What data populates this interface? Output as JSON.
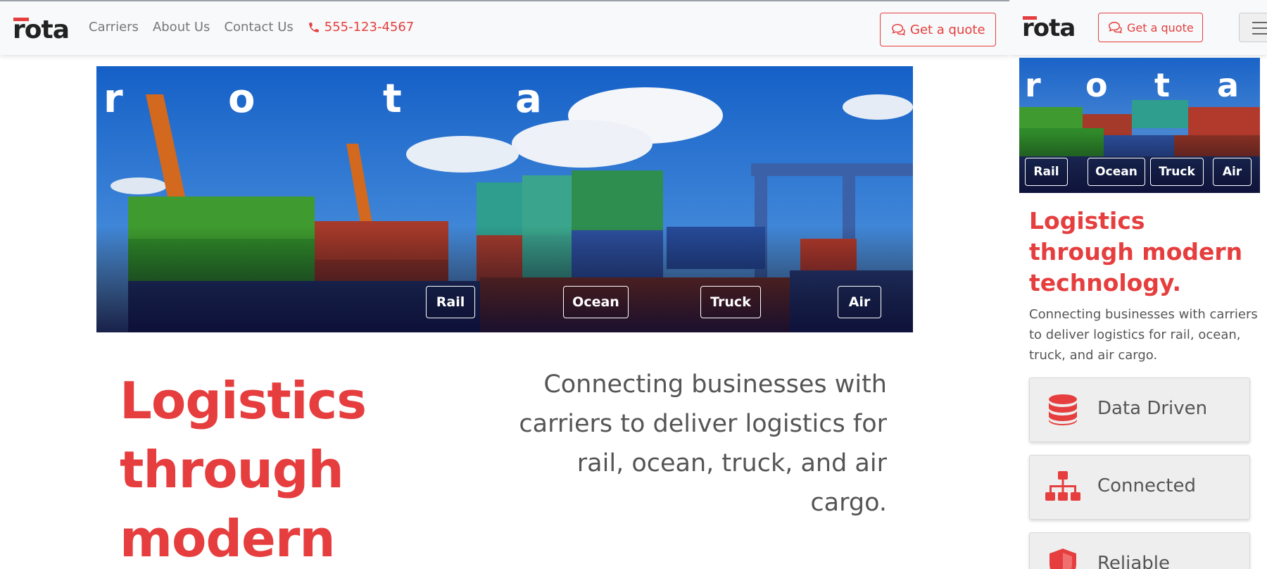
{
  "brand": {
    "logo_text": "rota",
    "accent_color": "#e63e3e"
  },
  "nav": {
    "links": [
      "Carriers",
      "About Us",
      "Contact Us"
    ],
    "phone": "555-123-4567",
    "quote_label": "Get a quote"
  },
  "hero": {
    "letters": [
      "r",
      "o",
      "t",
      "a"
    ],
    "modes": [
      "Rail",
      "Ocean",
      "Truck",
      "Air"
    ]
  },
  "main": {
    "headline": "Logistics through modern technology.",
    "headline_visible_desktop": "Logistics through modern",
    "tagline": "Connecting businesses with carriers to deliver logistics for rail, ocean, truck, and air cargo."
  },
  "features": [
    {
      "label": "Data Driven",
      "icon": "database-icon"
    },
    {
      "label": "Connected",
      "icon": "network-icon"
    },
    {
      "label": "Reliable",
      "icon": "shield-icon"
    }
  ]
}
